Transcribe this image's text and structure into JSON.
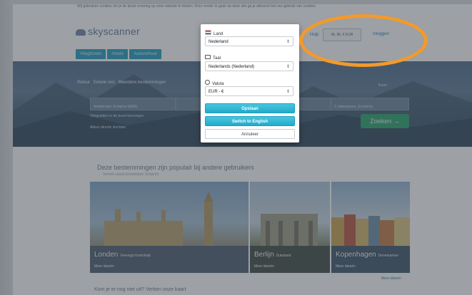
{
  "page": {
    "notice": "Wij gebruiken cookies om je de beste ervaring op onze website te bieden. Door verder te gaan op deze site ga je akkoord met ons gebruik van cookies.",
    "logo": "skyscanner",
    "nav_tabs": [
      "Vliegtickets",
      "Hotels",
      "Autoverhuur"
    ],
    "header": {
      "help": "Hulp",
      "locale": "NL·NL·€ EUR",
      "login": "Inloggen"
    },
    "search": {
      "trip_options": [
        "Retour",
        "Enkele reis",
        "Meerdere bestemmingen"
      ],
      "from_value": "Amsterdam Schiphol (AMS)",
      "travellers_value": "1 volwassene, Economy",
      "checkbox_1": "Vliegvelden in de buurt toevoegen",
      "checkbox_2": "Alleen directe vluchten",
      "search_button": "Zoeken →",
      "map_link": "Kaart"
    },
    "popular": {
      "title": "Deze bestemmingen zijn populair bij andere gebruikers",
      "subtitle": "Vertrek vanuit Amsterdam Schiphol",
      "cards": [
        {
          "city": "Londen",
          "country": "Verenigd Koninkrijk",
          "link": "Meer ideeën"
        },
        {
          "city": "Berlijn",
          "country": "Duitsland",
          "link": "Meer ideeën"
        },
        {
          "city": "Kopenhagen",
          "country": "Denemarken",
          "link": "Meer ideeën"
        }
      ],
      "more_link": "Meer ideeën"
    },
    "bottom_title": "Kom je er nog niet uit? Verken onze kaart"
  },
  "modal": {
    "country_label": "Land",
    "country_value": "Nederland",
    "language_label": "Taal",
    "language_value": "Nederlands (Nederland)",
    "currency_label": "Valuta",
    "currency_value": "EUR - €",
    "save_button": "Opslaan",
    "switch_button": "Switch to English",
    "cancel_button": "Annuleer"
  },
  "colors": {
    "accent": "#22aac9",
    "highlight_ring": "#f39a2b",
    "search_button": "#27a36a"
  }
}
